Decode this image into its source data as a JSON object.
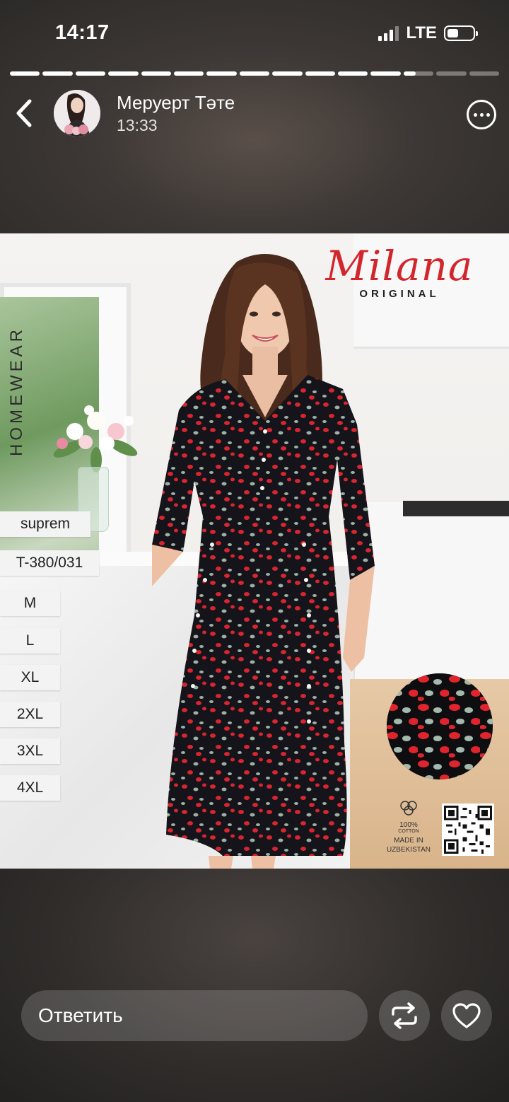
{
  "status_bar": {
    "time": "14:17",
    "network": "LTE",
    "battery_level": 0.45
  },
  "story_progress": {
    "segments": 15,
    "completed": 12,
    "current_fraction": 0.4
  },
  "header": {
    "user_name": "Меруерт Тәте",
    "timestamp": "13:33",
    "back_icon": "chevron-left-icon",
    "more_icon": "more-dots-icon"
  },
  "story_content": {
    "brand_name": "Milana",
    "brand_subtitle": "ORIGINAL",
    "category": "HOMEWEAR",
    "product_line": "suprem",
    "article": "T-380/031",
    "sizes": [
      "M",
      "L",
      "XL",
      "2XL",
      "3XL",
      "4XL"
    ],
    "cotton_percent": "100%",
    "cotton_label": "COTTON",
    "made_in_line1": "MADE IN",
    "made_in_line2": "UZBEKISTAN",
    "colors": {
      "brand_red": "#d3262c",
      "dress_black": "#15141a",
      "dot_red": "#d8252f",
      "dot_sage": "#9cb1a4"
    }
  },
  "footer": {
    "reply_placeholder": "Ответить",
    "repost_icon": "repost-icon",
    "like_icon": "heart-icon"
  }
}
